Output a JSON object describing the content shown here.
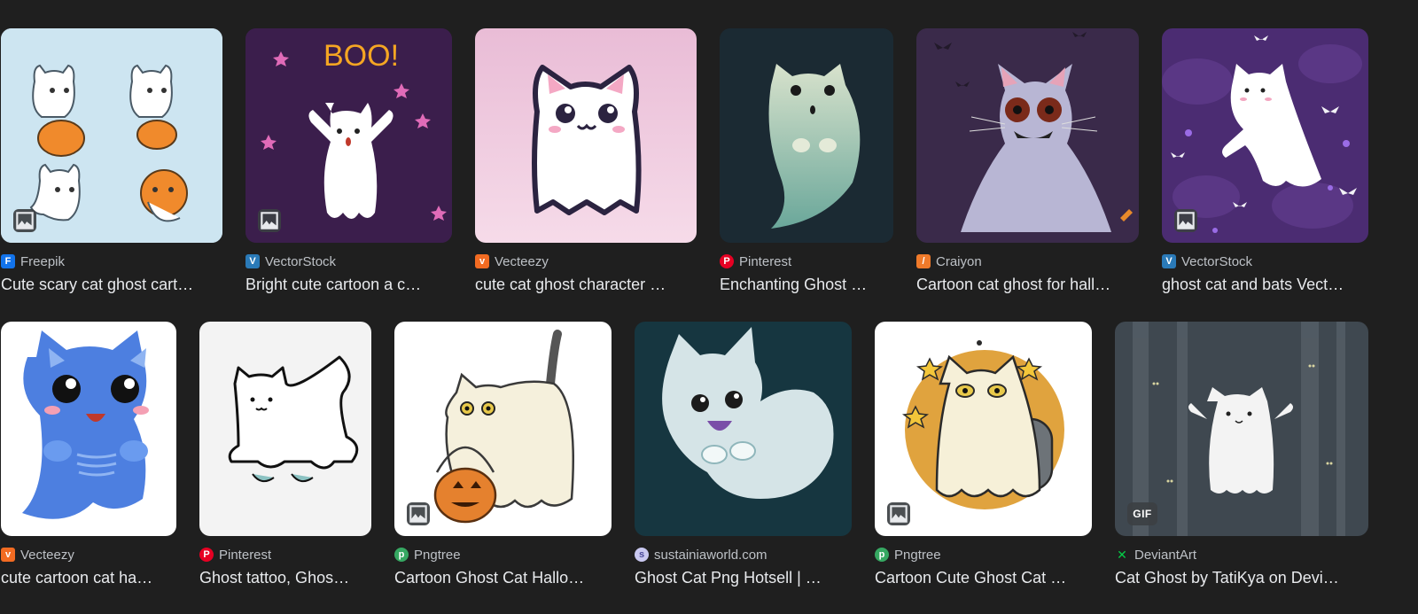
{
  "results": [
    {
      "source": "Freepik",
      "title": "Cute scary cat ghost cart…",
      "icon": "freepik-favicon",
      "badge": "image-icon"
    },
    {
      "source": "VectorStock",
      "title": "Bright cute cartoon a c…",
      "icon": "vectorstock-favicon",
      "badge": "image-icon",
      "image_text": "BOO!"
    },
    {
      "source": "Vecteezy",
      "title": "cute cat ghost character …",
      "icon": "vecteezy-favicon"
    },
    {
      "source": "Pinterest",
      "title": "Enchanting Ghost …",
      "icon": "pinterest-favicon"
    },
    {
      "source": "Craiyon",
      "title": "Cartoon cat ghost for hall…",
      "icon": "craiyon-favicon"
    },
    {
      "source": "VectorStock",
      "title": "ghost cat and bats Vect…",
      "icon": "vectorstock-favicon",
      "badge": "image-icon"
    },
    {
      "source": "Vecteezy",
      "title": "cute cartoon cat ha…",
      "icon": "vecteezy-favicon"
    },
    {
      "source": "Pinterest",
      "title": "Ghost tattoo, Ghos…",
      "icon": "pinterest-favicon"
    },
    {
      "source": "Pngtree",
      "title": "Cartoon Ghost Cat Hallo…",
      "icon": "pngtree-favicon",
      "badge": "image-icon"
    },
    {
      "source": "sustainiaworld.com",
      "title": "Ghost Cat Png Hotsell | …",
      "icon": "sustainiaworld-favicon"
    },
    {
      "source": "Pngtree",
      "title": "Cartoon Cute Ghost Cat …",
      "icon": "pngtree-favicon",
      "badge": "image-icon"
    },
    {
      "source": "DeviantArt",
      "title": "Cat Ghost by TatiKya on Devi…",
      "icon": "deviantart-favicon",
      "badge": "GIF"
    }
  ]
}
